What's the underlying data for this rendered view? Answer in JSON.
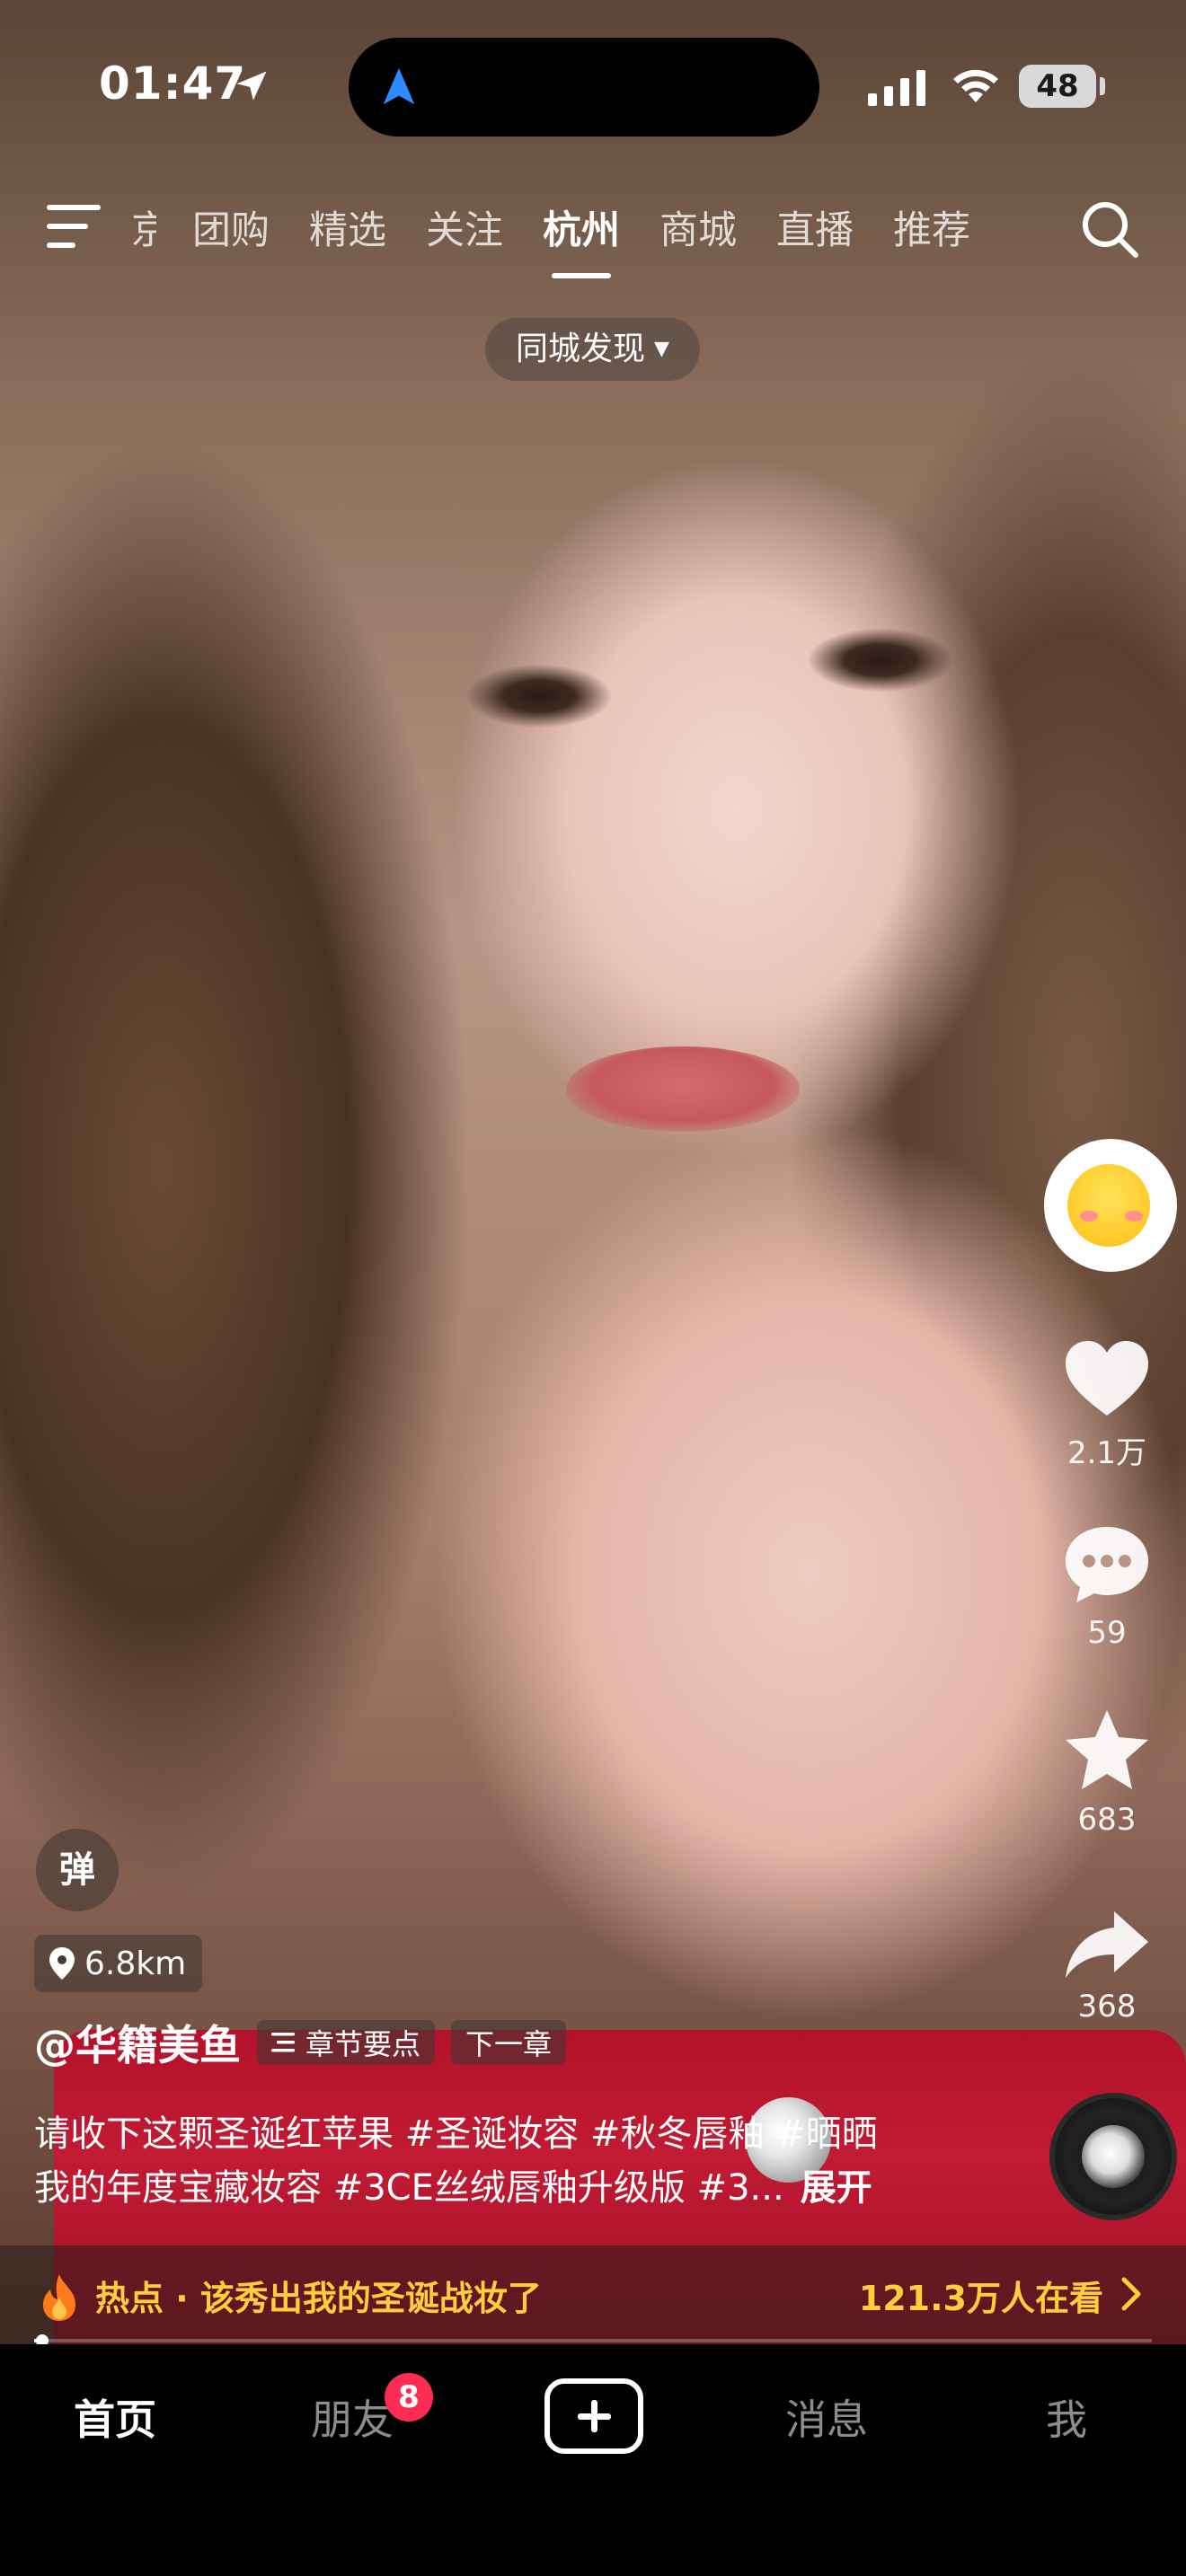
{
  "status_bar": {
    "time": "01:47",
    "battery": "48",
    "icons": [
      "location-arrow-icon",
      "navigation-icon",
      "signal-icon",
      "wifi-icon",
      "battery-icon"
    ]
  },
  "top_tabs": {
    "partial": "京",
    "items": [
      "团购",
      "精选",
      "关注",
      "杭州",
      "商城",
      "直播",
      "推荐"
    ],
    "active": "杭州"
  },
  "city_discover": {
    "label": "同城发现"
  },
  "rail": {
    "likes": "2.1万",
    "comments": "59",
    "favorites": "683",
    "shares": "368"
  },
  "video_info": {
    "danmaku": "弹",
    "distance": "6.8km",
    "author": "@华籍美鱼",
    "chapter_points": "章节要点",
    "next_chapter": "下一章",
    "description_line1": "请收下这颗圣诞红苹果 #圣诞妆容 #秋冬唇釉 #晒晒",
    "description_line2": "我的年度宝藏妆容 #3CE丝绒唇釉升级版 #3...",
    "expand": "展开"
  },
  "hot_banner": {
    "text": "热点 · 该秀出我的圣诞战妆了",
    "viewers": "121.3万人在看"
  },
  "playback": {
    "progress": 0.007
  },
  "bottom_nav": {
    "home": "首页",
    "friends": "朋友",
    "friends_badge": "8",
    "messages": "消息",
    "me": "我",
    "active": "首页"
  },
  "colors": {
    "hot_accent": "#ffce3d",
    "badge": "#fe2c55",
    "nav_background": "#000000"
  }
}
